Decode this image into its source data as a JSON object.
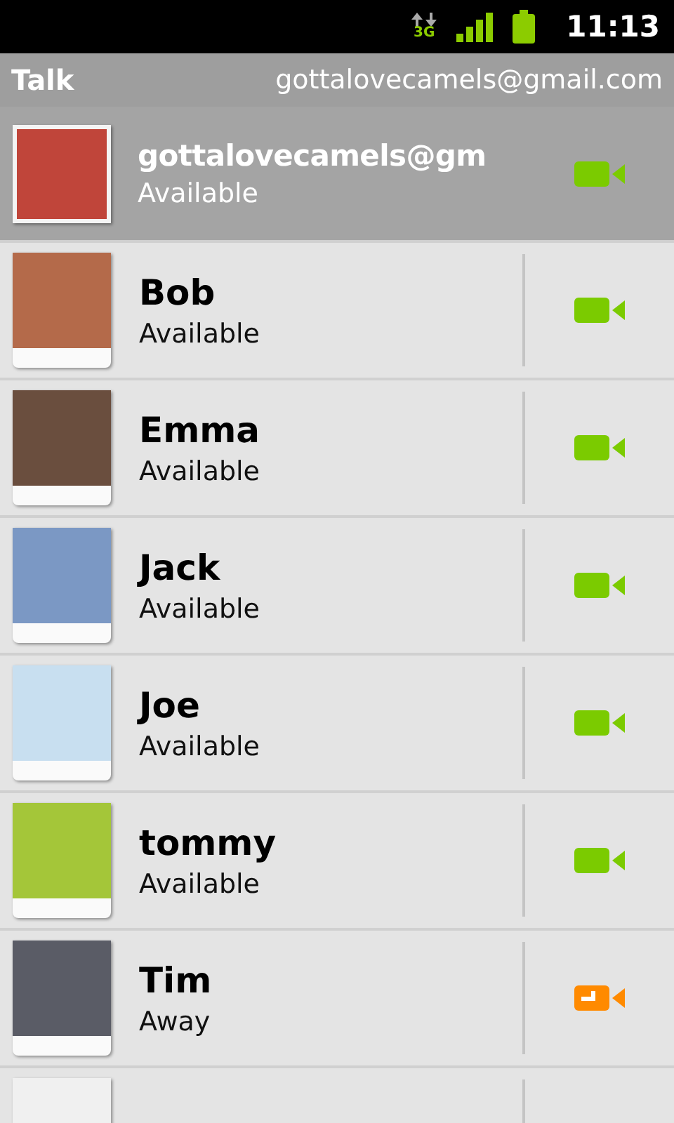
{
  "status_bar": {
    "time": "11:13",
    "network": "3G"
  },
  "title_bar": {
    "app": "Talk",
    "account": "gottalovecamels@gmail.com"
  },
  "self": {
    "name": "gottalovecamels@gm",
    "status": "Available",
    "away": false
  },
  "contacts": [
    {
      "name": "Bob",
      "status": "Available",
      "away": false
    },
    {
      "name": "Emma",
      "status": "Available",
      "away": false
    },
    {
      "name": "Jack",
      "status": "Available",
      "away": false
    },
    {
      "name": "Joe",
      "status": "Available",
      "away": false
    },
    {
      "name": "tommy",
      "status": "Available",
      "away": false
    },
    {
      "name": "Tim",
      "status": "Away",
      "away": true
    }
  ]
}
